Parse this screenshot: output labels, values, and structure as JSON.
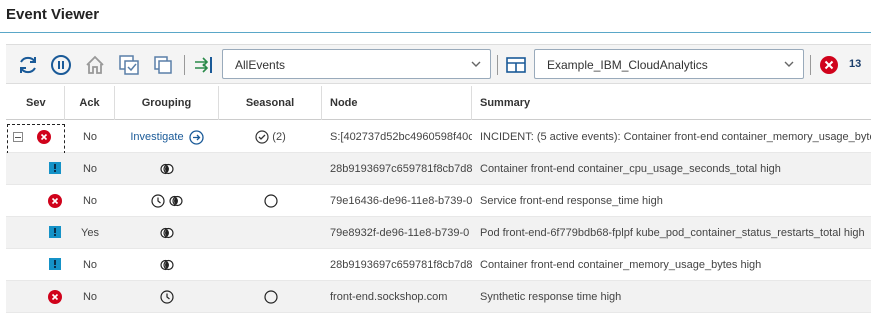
{
  "header": {
    "title": "Event Viewer"
  },
  "toolbar": {
    "filter_value": "AllEvents",
    "view_value": "Example_IBM_CloudAnalytics",
    "critical_count": "13",
    "colors": {
      "icon_blue": "#1a5a98",
      "critical_red": "#d0021b",
      "toolbar_bg": "#f4f4f4"
    }
  },
  "columns": [
    "Sev",
    "Ack",
    "Grouping",
    "Seasonal",
    "Node",
    "Summary"
  ],
  "rows": [
    {
      "sev": "critical",
      "ack": "No",
      "grouping": "Investigate",
      "grouping_icons": [
        "investigate-arrow"
      ],
      "seasonal": "(2)",
      "seasonal_icon": "check-circle",
      "node": "S:[402737d52bc4960598f40c",
      "summary": "INCIDENT: (5 active events): Container front-end container_memory_usage_byte"
    },
    {
      "sev": "warning",
      "ack": "No",
      "grouping": "",
      "grouping_icons": [
        "related"
      ],
      "seasonal": "",
      "seasonal_icon": "",
      "node": "28b9193697c659781f8cb7d8",
      "summary": "Container front-end container_cpu_usage_seconds_total high"
    },
    {
      "sev": "critical",
      "ack": "No",
      "grouping": "",
      "grouping_icons": [
        "temporal",
        "related"
      ],
      "seasonal": "",
      "seasonal_icon": "empty-circle",
      "node": "79e16436-de96-11e8-b739-0",
      "summary": "Service front-end response_time high"
    },
    {
      "sev": "warning",
      "ack": "Yes",
      "grouping": "",
      "grouping_icons": [
        "related"
      ],
      "seasonal": "",
      "seasonal_icon": "",
      "node": "79e8932f-de96-11e8-b739-0",
      "summary": "Pod front-end-6f779bdb68-fplpf kube_pod_container_status_restarts_total high"
    },
    {
      "sev": "warning",
      "ack": "No",
      "grouping": "",
      "grouping_icons": [
        "related"
      ],
      "seasonal": "",
      "seasonal_icon": "",
      "node": "28b9193697c659781f8cb7d8",
      "summary": "Container front-end container_memory_usage_bytes high"
    },
    {
      "sev": "critical",
      "ack": "No",
      "grouping": "",
      "grouping_icons": [
        "temporal"
      ],
      "seasonal": "",
      "seasonal_icon": "empty-circle",
      "node": "front-end.sockshop.com",
      "summary": "Synthetic response time high"
    }
  ]
}
